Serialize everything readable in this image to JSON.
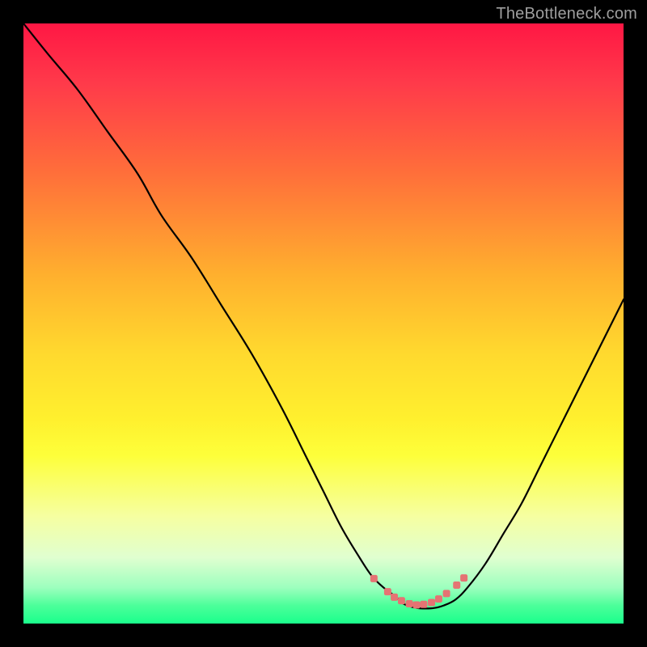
{
  "attribution": "TheBottleneck.com",
  "colors": {
    "frame": "#000000",
    "curve_stroke": "#000000",
    "marker_fill": "#e57373",
    "gradient_top": "#ff1744",
    "gradient_bottom": "#1aff8c"
  },
  "chart_data": {
    "type": "line",
    "title": "",
    "xlabel": "",
    "ylabel": "",
    "xlim": [
      0,
      100
    ],
    "ylim": [
      0,
      100
    ],
    "grid": false,
    "series": [
      {
        "name": "bottleneck-curve",
        "x": [
          0,
          4,
          9,
          14,
          19,
          23,
          28,
          33,
          38,
          43,
          47,
          50,
          53,
          56,
          58,
          60,
          62,
          63,
          64,
          65.5,
          67,
          68.5,
          70,
          72,
          74,
          77,
          80,
          83,
          86,
          89,
          92,
          95,
          98,
          100
        ],
        "y": [
          100,
          95,
          89,
          82,
          75,
          68,
          61,
          53,
          45,
          36,
          28,
          22,
          16,
          11,
          8,
          6,
          4.5,
          3.5,
          3,
          2.6,
          2.5,
          2.6,
          3,
          4,
          6,
          10,
          15,
          20,
          26,
          32,
          38,
          44,
          50,
          54
        ]
      }
    ],
    "markers": {
      "name": "highlight-points",
      "x": [
        58.4,
        60.7,
        61.8,
        63.0,
        64.3,
        65.5,
        66.7,
        68.0,
        69.2,
        70.5,
        72.2,
        73.4
      ],
      "y": [
        7.5,
        5.3,
        4.4,
        3.8,
        3.3,
        3.1,
        3.2,
        3.5,
        4.1,
        5.0,
        6.4,
        7.6
      ]
    }
  }
}
